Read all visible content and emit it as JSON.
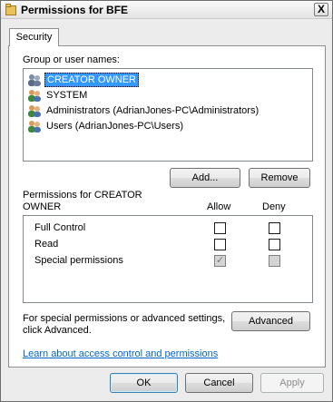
{
  "window": {
    "title": "Permissions for BFE",
    "close_label": "X"
  },
  "tabs": [
    {
      "label": "Security",
      "selected": true
    }
  ],
  "group_section": {
    "label": "Group or user names:",
    "items": [
      {
        "label": "CREATOR OWNER",
        "selected": true,
        "icon": "user-group-icon"
      },
      {
        "label": "SYSTEM",
        "selected": false,
        "icon": "user-group-icon"
      },
      {
        "label": "Administrators (AdrianJones-PC\\Administrators)",
        "selected": false,
        "icon": "user-group-icon"
      },
      {
        "label": "Users (AdrianJones-PC\\Users)",
        "selected": false,
        "icon": "user-group-icon"
      }
    ],
    "add_button": "Add...",
    "remove_button": "Remove"
  },
  "permissions_section": {
    "label_line1": "Permissions for CREATOR",
    "label_line2": "OWNER",
    "allow_header": "Allow",
    "deny_header": "Deny",
    "rows": [
      {
        "name": "Full Control",
        "allow": false,
        "deny": false,
        "disabled": false
      },
      {
        "name": "Read",
        "allow": false,
        "deny": false,
        "disabled": false
      },
      {
        "name": "Special permissions",
        "allow": true,
        "deny": false,
        "disabled": true
      }
    ]
  },
  "advanced_section": {
    "text_line1": "For special permissions or advanced settings,",
    "text_line2": "click Advanced.",
    "button": "Advanced"
  },
  "help_link": "Learn about access control and permissions",
  "footer": {
    "ok": "OK",
    "cancel": "Cancel",
    "apply": "Apply"
  }
}
